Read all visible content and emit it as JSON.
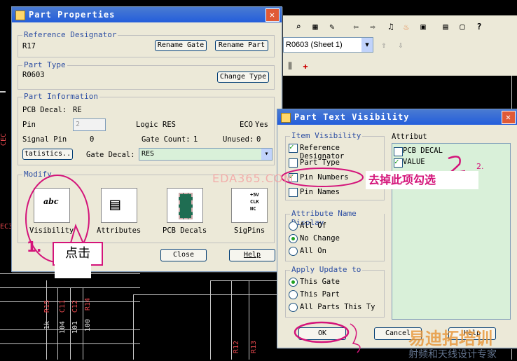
{
  "toolbar": {
    "sheet_select": "R0603 (Sheet 1)"
  },
  "schematic": {
    "labels": [
      "CEC",
      "EC3",
      "R15",
      "C11",
      "C12",
      "R14",
      "1k",
      "104",
      "101",
      "100",
      "R12",
      "R13"
    ]
  },
  "part_properties": {
    "title": "Part Properties",
    "ref_group": "Reference Designator",
    "ref_value": "R17",
    "rename_gate": "Rename Gate",
    "rename_part": "Rename Part",
    "type_group": "Part Type",
    "type_value": "R0603",
    "change_type": "Change Type",
    "info_group": "Part Information",
    "pcb_decal_label": "PCB Decal:",
    "pcb_decal_value": "RE",
    "pin_label": "Pin",
    "pin_value": "2",
    "logic_label": "Logic",
    "logic_value": "RES",
    "eco_label": "ECO",
    "eco_value": "Yes",
    "signal_pin_label": "Signal Pin",
    "signal_pin_value": "0",
    "gate_count_label": "Gate Count:",
    "gate_count_value": "1",
    "unused_label": "Unused:",
    "unused_value": "0",
    "statistics_btn": "tatistics..",
    "gate_decal_label": "Gate Decal:",
    "gate_decal_value": "RES",
    "modify_group": "Modify",
    "visibility_label": "Visibility",
    "attributes_label": "Attributes",
    "pcb_decals_label": "PCB Decals",
    "sigpins_label": "SigPins",
    "sigpin_lines": [
      "+5V",
      "CLK",
      "NC"
    ],
    "close_btn": "Close",
    "help_btn": "Help"
  },
  "text_visibility": {
    "title": "Part Text Visibility",
    "item_group": "Item Visibility",
    "items": [
      {
        "label": "Reference Designator",
        "checked": true
      },
      {
        "label": "Part Type",
        "checked": false
      },
      {
        "label": "Pin Numbers",
        "checked": true
      },
      {
        "label": "Pin Names",
        "checked": false
      }
    ],
    "attr_group": "Attribut",
    "attributes": [
      {
        "label": "PCB DECAL",
        "checked": false
      },
      {
        "label": "VALUE",
        "checked": true
      }
    ],
    "name_display_group": "Attribute Name Display",
    "name_display": [
      {
        "label": "All Of",
        "selected": false
      },
      {
        "label": "No Change",
        "selected": true
      },
      {
        "label": "All On",
        "selected": false
      }
    ],
    "apply_group": "Apply Update to",
    "apply": [
      {
        "label": "This Gate",
        "selected": true
      },
      {
        "label": "This Part",
        "selected": false
      },
      {
        "label": "All Parts This Ty",
        "selected": false
      }
    ],
    "ok_btn": "OK",
    "cancel_btn": "Cancel",
    "help_btn": "Help"
  },
  "annotations": {
    "step1": "1.",
    "click": "点击",
    "step2": "2.",
    "uncheck": "去掉此项勾选",
    "watermark": "EDA365.COM",
    "brand": "易迪拓培训",
    "brand_sub": "射频和天线设计专家"
  },
  "colors": {
    "accent": "#245edb",
    "annotation": "#d4147a",
    "watermark": "#f4a0a0",
    "brand": "#e89a40"
  }
}
